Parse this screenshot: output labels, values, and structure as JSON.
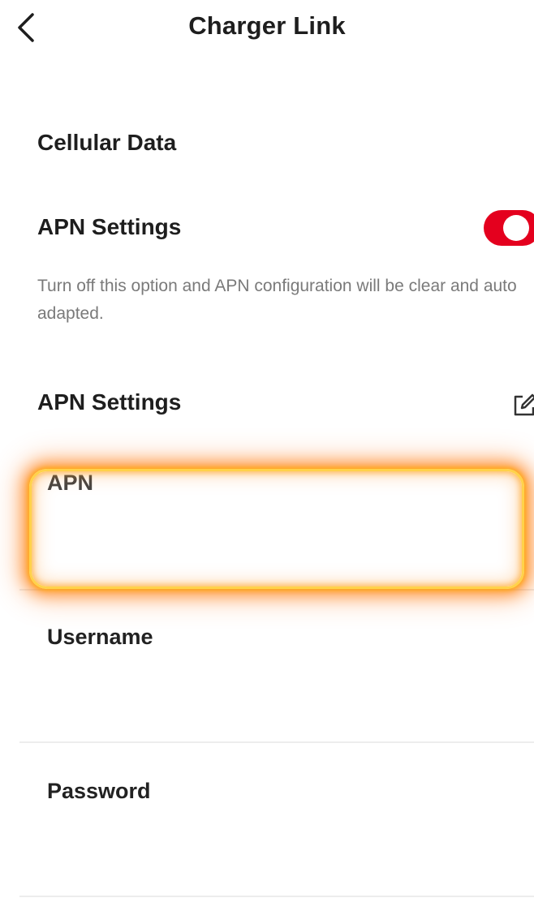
{
  "header": {
    "title": "Charger Link",
    "back_icon": "chevron-left-icon"
  },
  "cellular": {
    "section_title": "Cellular Data",
    "apn_toggle": {
      "label": "APN Settings",
      "state": "on",
      "color": "#e4001e"
    },
    "help_text": "Turn off this option and APN configuration will be clear and auto adapted."
  },
  "apn_settings": {
    "label": "APN Settings",
    "edit_icon": "edit-icon",
    "fields": {
      "apn": {
        "label": "APN",
        "value": "",
        "highlighted": true
      },
      "username": {
        "label": "Username",
        "value": ""
      },
      "password": {
        "label": "Password",
        "value": ""
      }
    }
  },
  "colors": {
    "accent": "#e4001e",
    "highlight": "#ffa51e",
    "muted_text": "#7a7a7a"
  }
}
